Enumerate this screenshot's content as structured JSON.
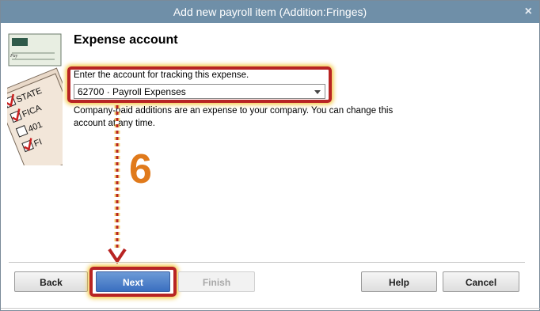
{
  "window": {
    "title": "Add new payroll item (Addition:Fringes)",
    "close_glyph": "×"
  },
  "page": {
    "heading": "Expense account",
    "instruction": "Enter the account for tracking this expense.",
    "account_select": {
      "value": "62700 · Payroll Expenses"
    },
    "description": "Company-paid additions are an expense to your company. You can change this account at any time."
  },
  "annotation": {
    "step_number": "6"
  },
  "buttons": {
    "back": "Back",
    "next": "Next",
    "finish": "Finish",
    "help": "Help",
    "cancel": "Cancel"
  },
  "side_art": {
    "labels": [
      "STATE",
      "FICA",
      "401",
      "FI"
    ],
    "pay_label": "Pay"
  },
  "colors": {
    "highlight": "#b82423",
    "glow": "#f3c53b",
    "step": "#e07a1b",
    "titlebar": "#6f8fa8"
  }
}
